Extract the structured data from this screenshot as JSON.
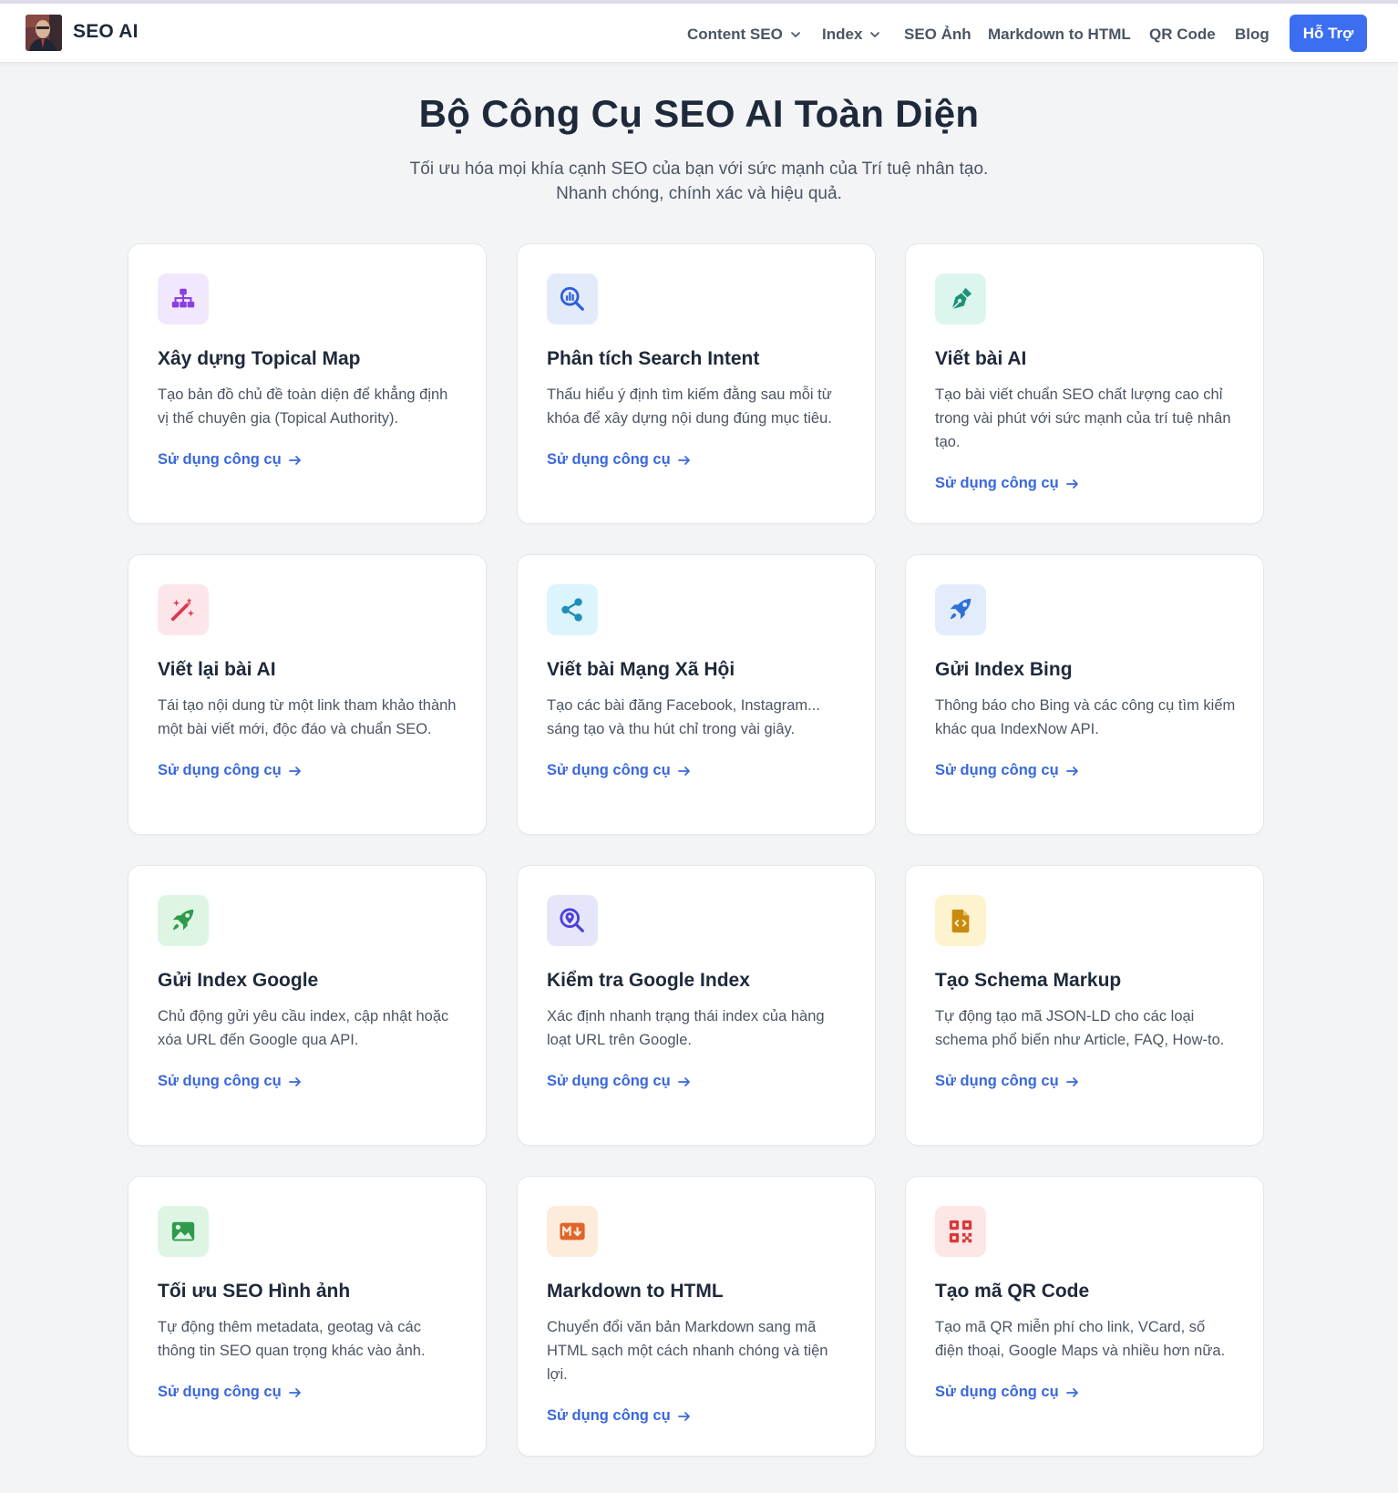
{
  "header": {
    "brand": "SEO AI",
    "nav": [
      {
        "label": "Content SEO",
        "has_dropdown": true
      },
      {
        "label": "Index",
        "has_dropdown": true
      },
      {
        "label": "SEO Ảnh",
        "has_dropdown": false
      },
      {
        "label": "Markdown to HTML",
        "has_dropdown": false
      },
      {
        "label": "QR Code",
        "has_dropdown": false
      },
      {
        "label": "Blog",
        "has_dropdown": false
      }
    ],
    "support_label": "Hỗ Trợ"
  },
  "hero": {
    "title": "Bộ Công Cụ SEO AI Toàn Diện",
    "subtitle_line1": "Tối ưu hóa mọi khía cạnh SEO của bạn với sức mạnh của Trí tuệ nhân tạo.",
    "subtitle_line2": "Nhanh chóng, chính xác và hiệu quả."
  },
  "link_label": "Sử dụng công cụ",
  "tools": [
    {
      "icon": "sitemap-icon",
      "icon_color": "#8b3fe0",
      "icon_bg": "#f1e8fd",
      "title": "Xây dựng Topical Map",
      "desc": "Tạo bản đồ chủ đề toàn diện để khẳng định vị thế chuyên gia (Topical Authority)."
    },
    {
      "icon": "search-chart-icon",
      "icon_color": "#2f5fd8",
      "icon_bg": "#e3ebfb",
      "title": "Phân tích Search Intent",
      "desc": "Thấu hiểu ý định tìm kiếm đằng sau mỗi từ khóa để xây dựng nội dung đúng mục tiêu."
    },
    {
      "icon": "pen-nib-icon",
      "icon_color": "#1f9178",
      "icon_bg": "#dcf6ef",
      "title": "Viết bài AI",
      "desc": "Tạo bài viết chuẩn SEO chất lượng cao chỉ trong vài phút với sức mạnh của trí tuệ nhân tạo."
    },
    {
      "icon": "magic-wand-icon",
      "icon_color": "#e0364f",
      "icon_bg": "#fde6e9",
      "title": "Viết lại bài AI",
      "desc": "Tái tạo nội dung từ một link tham khảo thành một bài viết mới, độc đáo và chuẩn SEO."
    },
    {
      "icon": "share-icon",
      "icon_color": "#1f8fb8",
      "icon_bg": "#dcf4fb",
      "title": "Viết bài Mạng Xã Hội",
      "desc": "Tạo các bài đăng Facebook, Instagram... sáng tạo và thu hút chỉ trong vài giây."
    },
    {
      "icon": "rocket-icon",
      "icon_color": "#2f6fd8",
      "icon_bg": "#e3ecfb",
      "title": "Gửi Index Bing",
      "desc": "Thông báo cho Bing và các công cụ tìm kiếm khác qua IndexNow API."
    },
    {
      "icon": "rocket-icon",
      "icon_color": "#2f9a4a",
      "icon_bg": "#def5e4",
      "title": "Gửi Index Google",
      "desc": "Chủ động gửi yêu cầu index, cập nhật hoặc xóa URL đến Google qua API."
    },
    {
      "icon": "search-location-icon",
      "icon_color": "#4b3fd8",
      "icon_bg": "#e6e6fb",
      "title": "Kiểm tra Google Index",
      "desc": "Xác định nhanh trạng thái index của hàng loạt URL trên Google."
    },
    {
      "icon": "code-file-icon",
      "icon_color": "#c98a0e",
      "icon_bg": "#fdf3cf",
      "title": "Tạo Schema Markup",
      "desc": "Tự động tạo mã JSON-LD cho các loại schema phổ biến như Article, FAQ, How-to."
    },
    {
      "icon": "image-icon",
      "icon_color": "#2f9a4a",
      "icon_bg": "#def5e4",
      "title": "Tối ưu SEO Hình ảnh",
      "desc": "Tự động thêm metadata, geotag và các thông tin SEO quan trọng khác vào ảnh."
    },
    {
      "icon": "markdown-icon",
      "icon_color": "#e0652a",
      "icon_bg": "#fdebdc",
      "title": "Markdown to HTML",
      "desc": "Chuyển đổi văn bản Markdown sang mã HTML sạch một cách nhanh chóng và tiện lợi."
    },
    {
      "icon": "qrcode-icon",
      "icon_color": "#d83b3b",
      "icon_bg": "#fde6e6",
      "title": "Tạo mã QR Code",
      "desc": "Tạo mã QR miễn phí cho link, VCard, số điện thoại, Google Maps và nhiều hơn nữa."
    }
  ],
  "colors": {
    "accent": "#3b6ef0",
    "link": "#3a68dc",
    "background": "#f3f4f6"
  }
}
